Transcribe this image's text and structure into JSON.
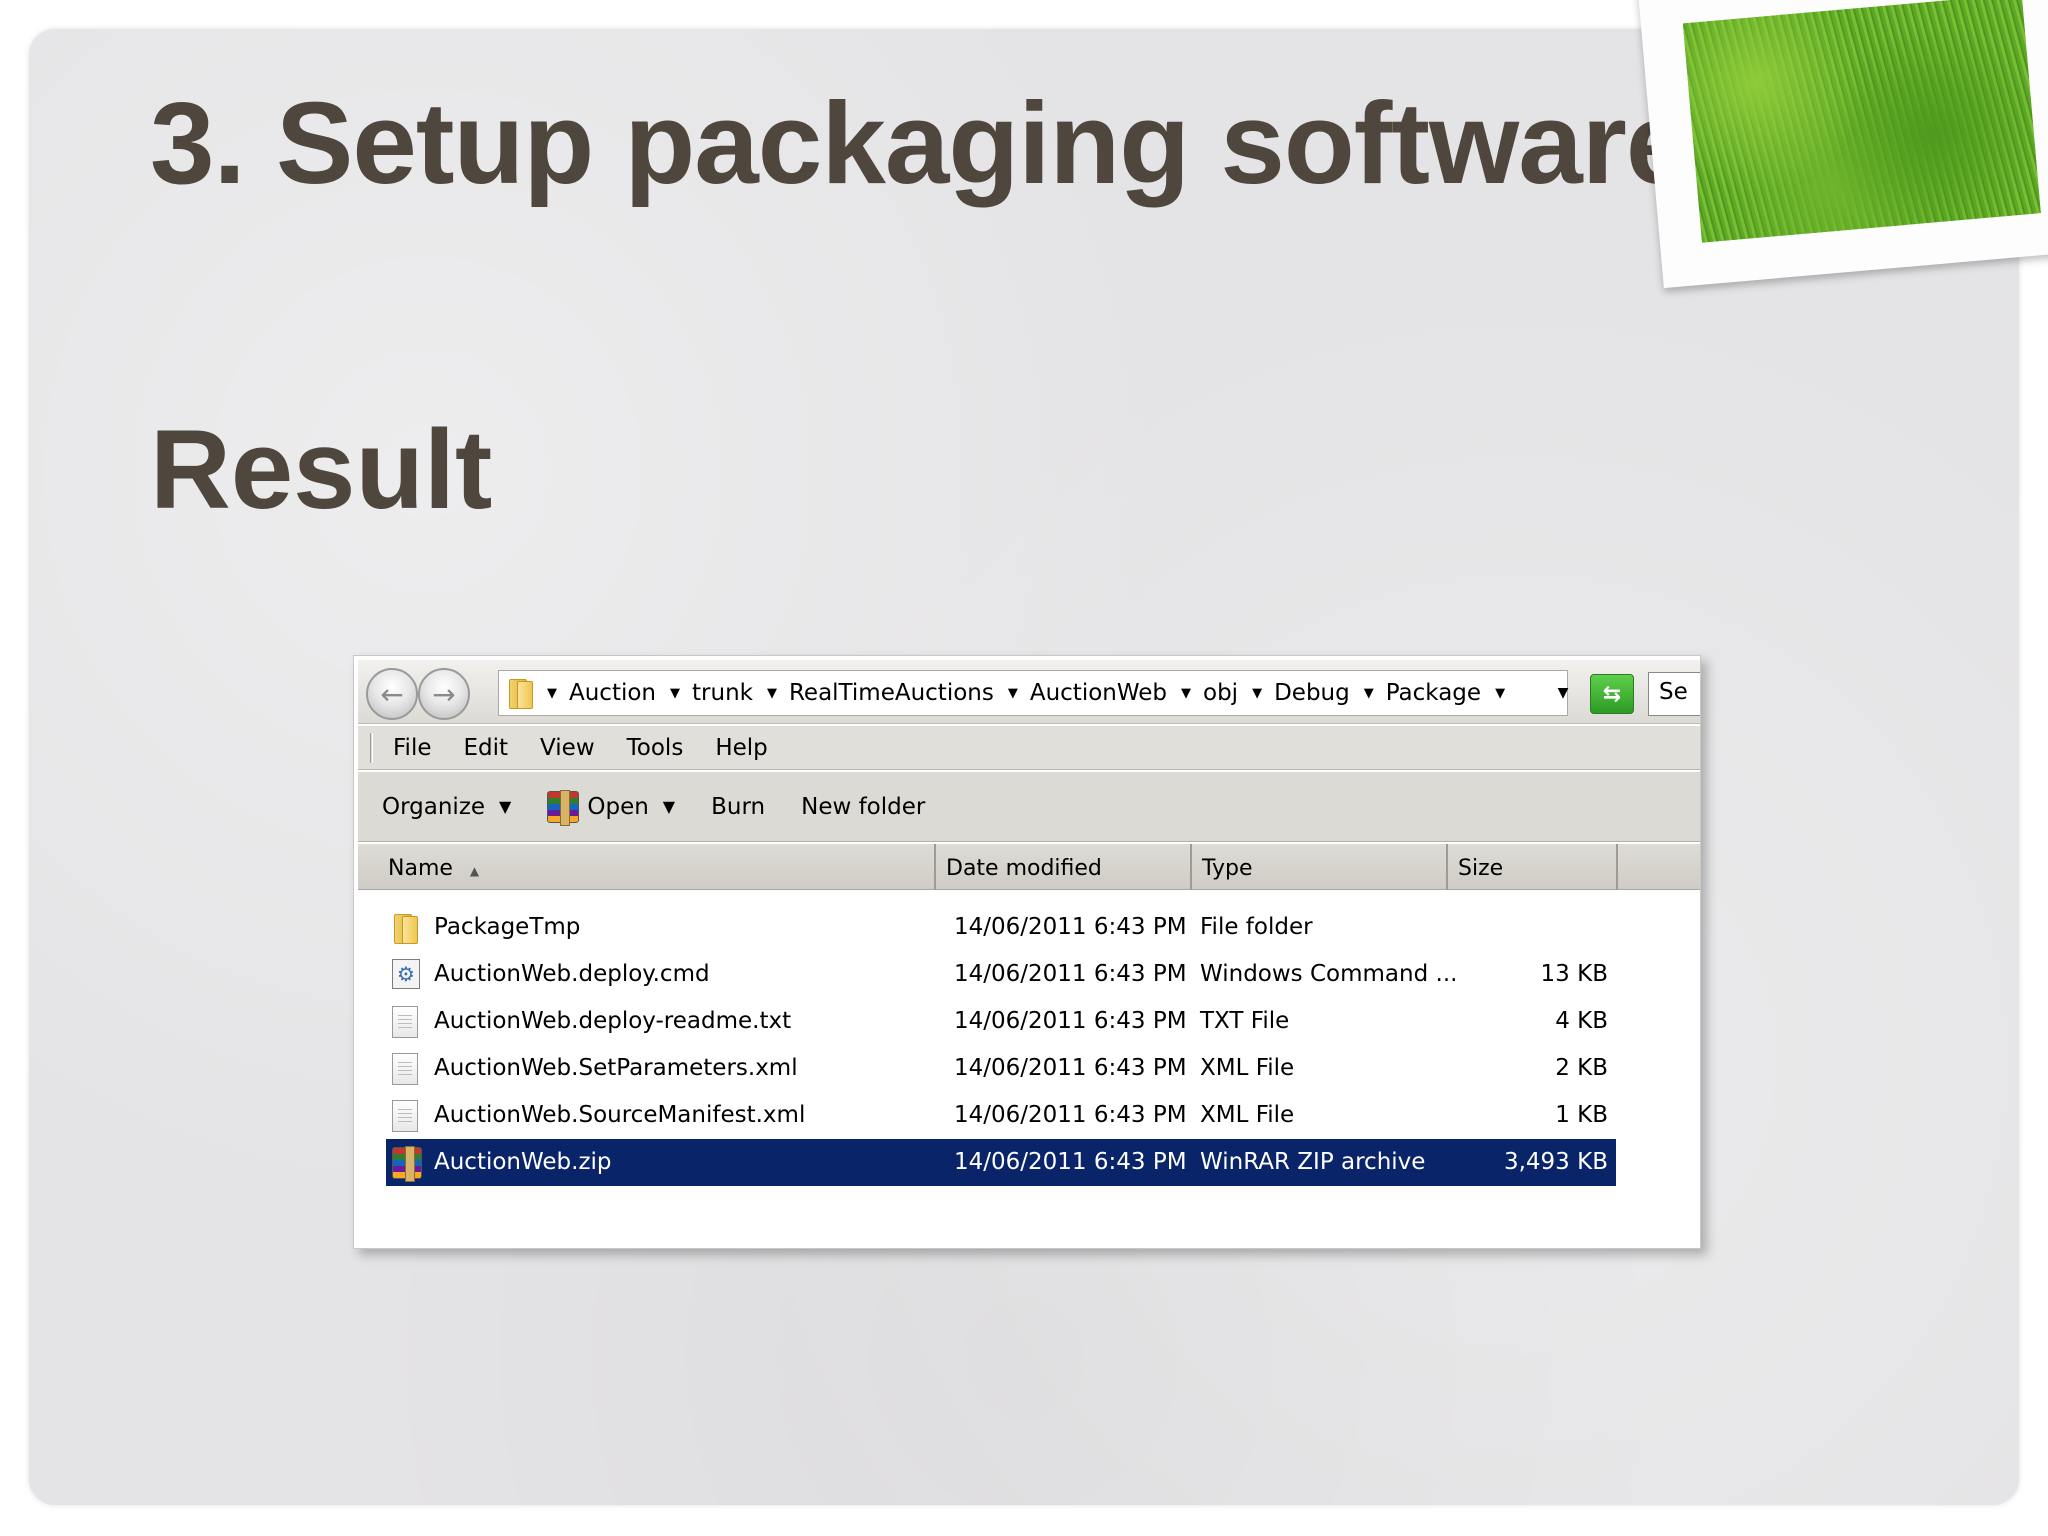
{
  "slide": {
    "title": "3. Setup packaging software",
    "subtitle": "Result"
  },
  "explorer": {
    "breadcrumbs": [
      "Auction",
      "trunk",
      "RealTimeAuctions",
      "AuctionWeb",
      "obj",
      "Debug",
      "Package"
    ],
    "search_placeholder": "Se",
    "menu": [
      "File",
      "Edit",
      "View",
      "Tools",
      "Help"
    ],
    "toolbar": {
      "organize": "Organize",
      "open": "Open",
      "burn": "Burn",
      "new_folder": "New folder"
    },
    "columns": {
      "name": "Name",
      "date": "Date modified",
      "type": "Type",
      "size": "Size"
    },
    "files": [
      {
        "name": "PackageTmp",
        "date": "14/06/2011 6:43 PM",
        "type": "File folder",
        "size": "",
        "icon": "folder-icon"
      },
      {
        "name": "AuctionWeb.deploy.cmd",
        "date": "14/06/2011 6:43 PM",
        "type": "Windows Command ...",
        "size": "13 KB",
        "icon": "cmd-file-icon"
      },
      {
        "name": "AuctionWeb.deploy-readme.txt",
        "date": "14/06/2011 6:43 PM",
        "type": "TXT File",
        "size": "4 KB",
        "icon": "text-file-icon"
      },
      {
        "name": "AuctionWeb.SetParameters.xml",
        "date": "14/06/2011 6:43 PM",
        "type": "XML File",
        "size": "2 KB",
        "icon": "xml-file-icon"
      },
      {
        "name": "AuctionWeb.SourceManifest.xml",
        "date": "14/06/2011 6:43 PM",
        "type": "XML File",
        "size": "1 KB",
        "icon": "xml-file-icon"
      },
      {
        "name": "AuctionWeb.zip",
        "date": "14/06/2011 6:43 PM",
        "type": "WinRAR ZIP archive",
        "size": "3,493 KB",
        "icon": "winrar-zip-icon",
        "selected": true
      }
    ]
  },
  "colors": {
    "title": "#4f473d",
    "selection": "#0a246a"
  }
}
